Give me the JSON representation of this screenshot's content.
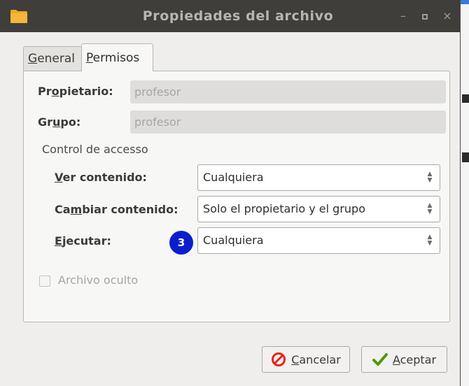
{
  "window": {
    "title": "Propiedades del archivo",
    "controls": {
      "minimize": "–",
      "maximize": "□",
      "close": "×"
    }
  },
  "tabs": [
    {
      "label": "General",
      "mnemonic_index": 0,
      "active": false
    },
    {
      "label": "Permisos",
      "mnemonic_index": 0,
      "active": true
    }
  ],
  "owner": {
    "label_pre": "Pr",
    "label_mn": "o",
    "label_post": "pietario:",
    "value": "profesor"
  },
  "group": {
    "label_pre": "Gr",
    "label_mn": "u",
    "label_post": "po:",
    "value": "profesor"
  },
  "access_control": {
    "title": "Control de accesso",
    "rows": [
      {
        "label_pre": "",
        "label_mn": "V",
        "label_post": "er contenido:",
        "value": "Cualquiera"
      },
      {
        "label_pre": "Ca",
        "label_mn": "m",
        "label_post": "biar contenido:",
        "value": "Solo el propietario y el grupo"
      },
      {
        "label_pre": "",
        "label_mn": "E",
        "label_post": "jecutar:",
        "value": "Cualquiera"
      }
    ]
  },
  "badge": "3",
  "hidden_file": {
    "label": "Archivo oculto",
    "checked": false,
    "enabled": false
  },
  "buttons": {
    "cancel": {
      "mn": "C",
      "rest": "ancelar"
    },
    "accept": {
      "mn": "A",
      "rest": "ceptar"
    }
  },
  "icons": {
    "title": "folder-icon",
    "cancel": "cancel-circle-icon",
    "accept": "checkmark-icon",
    "combo": "updown-arrows-icon"
  },
  "colors": {
    "titlebar": "#3f3e3a",
    "badge": "#0a1fcc",
    "folder": "#f5a623",
    "cancel_icon": "#e8231c",
    "accept_icon": "#4e9a06"
  }
}
